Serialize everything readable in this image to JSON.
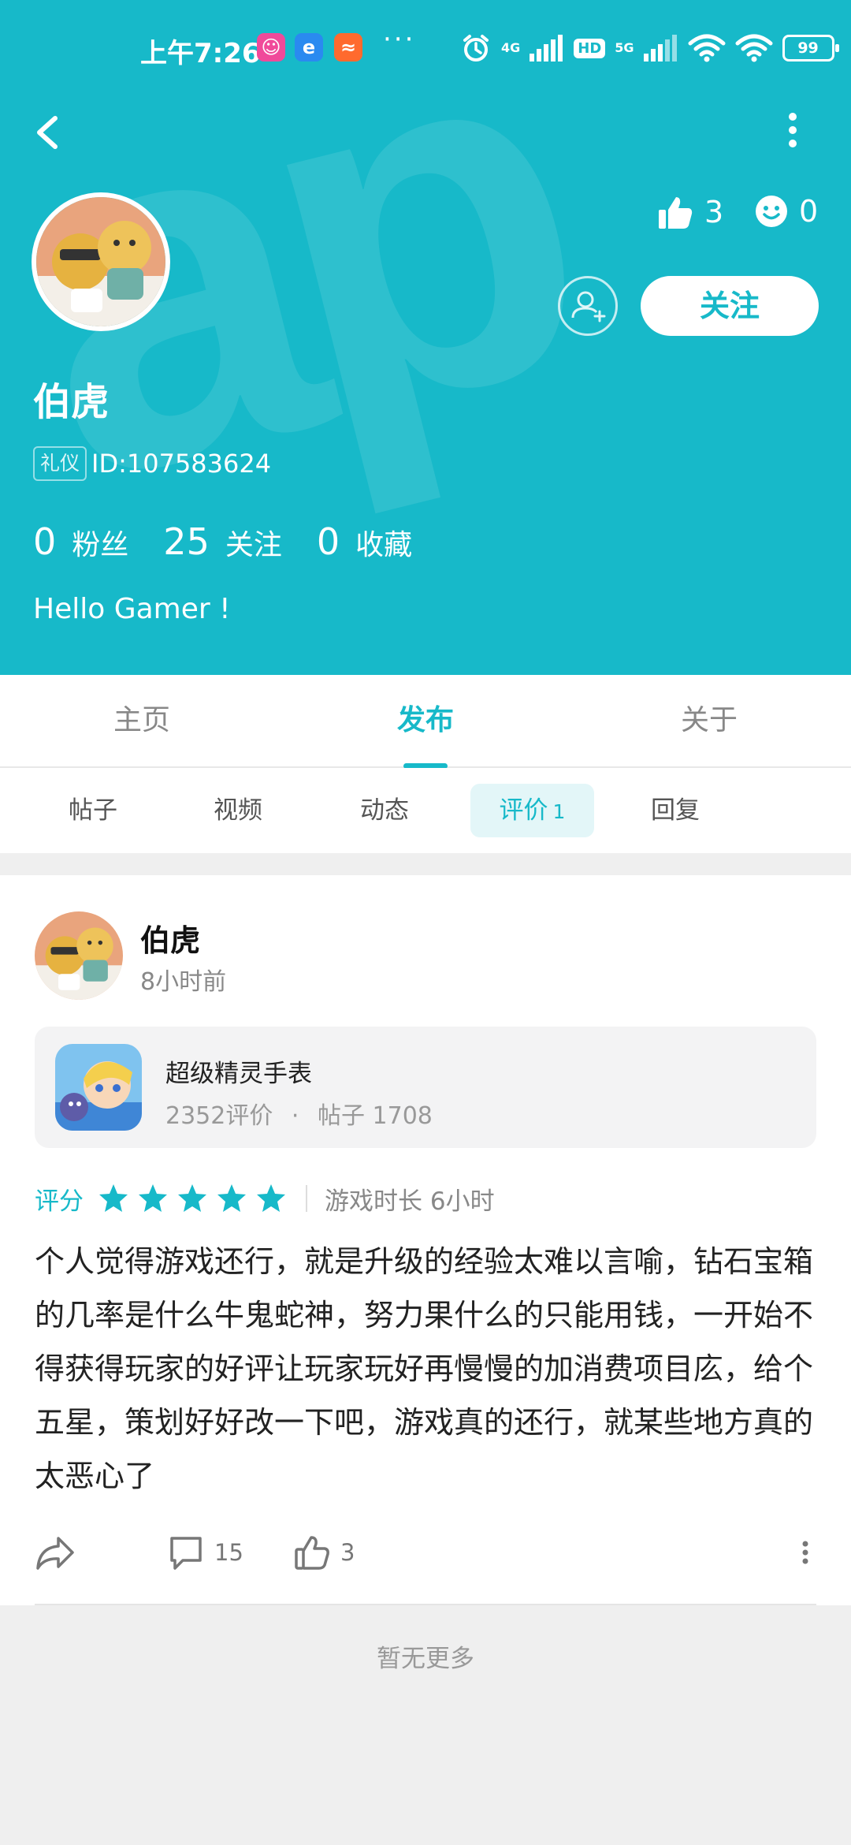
{
  "status_bar": {
    "time": "上午7:26",
    "more": "···",
    "net_4g": "4G",
    "hd": "HD",
    "net_5g": "5G",
    "battery": "99"
  },
  "profile": {
    "likes": "3",
    "smiles": "0",
    "follow_label": "关注",
    "name": "伯虎",
    "tag": "礼仪",
    "id_text": "ID:107583624",
    "counts": [
      {
        "num": "0",
        "label": "粉丝"
      },
      {
        "num": "25",
        "label": "关注"
      },
      {
        "num": "0",
        "label": "收藏"
      }
    ],
    "bio": "Hello Gamer !"
  },
  "tabs": {
    "main": [
      "主页",
      "发布",
      "关于"
    ],
    "active_main": 1,
    "sub": [
      "帖子",
      "视频",
      "动态",
      "评价",
      "回复"
    ],
    "sub_badge": "1",
    "active_sub": 3
  },
  "review": {
    "author": "伯虎",
    "time": "8小时前",
    "game_name": "超级精灵手表",
    "game_reviews": "2352评价",
    "game_sep": "·",
    "game_posts": "帖子 1708",
    "rating_label": "评分",
    "stars": 5,
    "play_time": "游戏时长 6小时",
    "text": "个人觉得游戏还行，就是升级的经验太难以言喻，钻石宝箱的几率是什么牛鬼蛇神，努力果什么的只能用钱，一开始不得获得玩家的好评让玩家玩好再慢慢的加消费项目庅，给个五星，策划好好改一下吧，游戏真的还行，就某些地方真的太恶心了",
    "comments": "15",
    "likes": "3"
  },
  "footer": {
    "no_more": "暂无更多"
  },
  "colors": {
    "accent": "#17b9c9",
    "star": "#17b9c9"
  }
}
